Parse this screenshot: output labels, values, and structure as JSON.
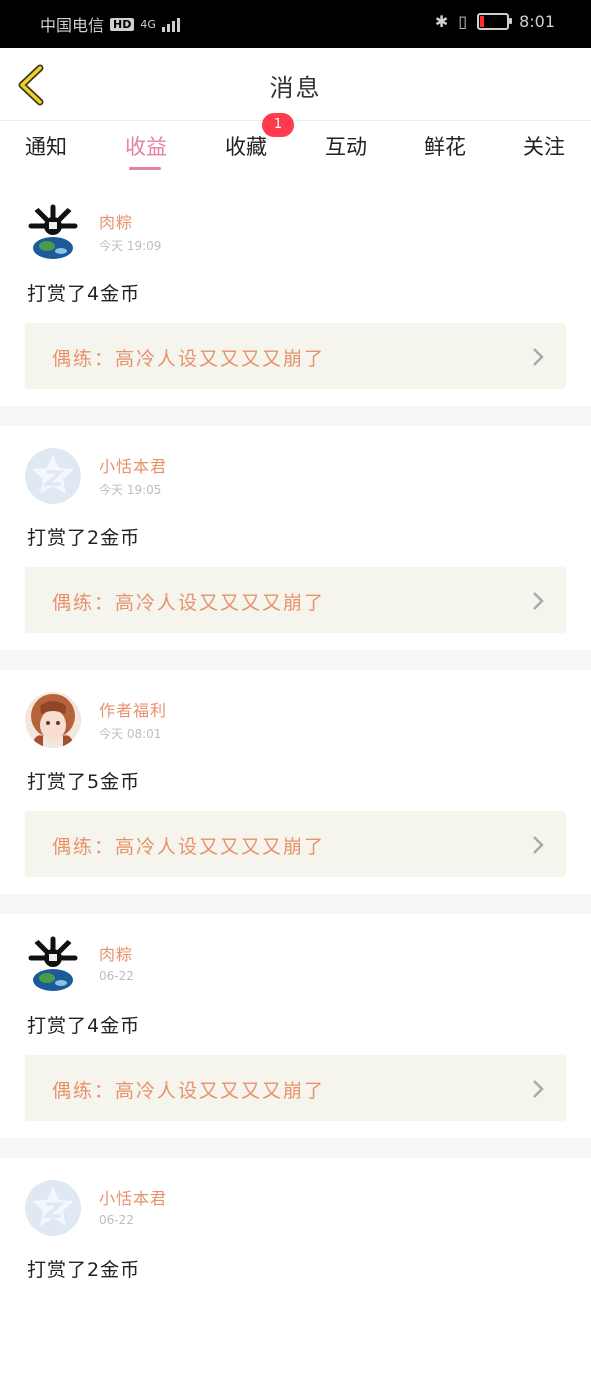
{
  "status_bar": {
    "carrier": "中国电信",
    "hd": "HD",
    "net": "4G",
    "time": "8:01"
  },
  "header": {
    "title": "消息"
  },
  "tabs": [
    {
      "label": "通知"
    },
    {
      "label": "收益",
      "active": true
    },
    {
      "label": "收藏",
      "badge": "1"
    },
    {
      "label": "互动"
    },
    {
      "label": "鲜花"
    },
    {
      "label": "关注"
    }
  ],
  "messages": [
    {
      "user": "肉粽",
      "time": "今天 19:09",
      "text": "打赏了4金币",
      "book": "偶练：高冷人设又又又又崩了",
      "avatar": "globe-avatar"
    },
    {
      "user": "小恬本君",
      "time": "今天 19:05",
      "text": "打赏了2金币",
      "book": "偶练：高冷人设又又又又崩了",
      "avatar": "qq-default-avatar"
    },
    {
      "user": "作者福利",
      "time": "今天 08:01",
      "text": "打赏了5金币",
      "book": "偶练：高冷人设又又又又崩了",
      "avatar": "anime-girl-avatar"
    },
    {
      "user": "肉粽",
      "time": "06-22",
      "text": "打赏了4金币",
      "book": "偶练：高冷人设又又又又崩了",
      "avatar": "globe-avatar"
    },
    {
      "user": "小恬本君",
      "time": "06-22",
      "text": "打赏了2金币",
      "book": "",
      "avatar": "qq-default-avatar"
    }
  ],
  "colors": {
    "accent_pink": "#e57fa6",
    "username_orange": "#e8926b",
    "badge_red": "#ff3b4d",
    "book_bg": "#f5f5ee"
  }
}
